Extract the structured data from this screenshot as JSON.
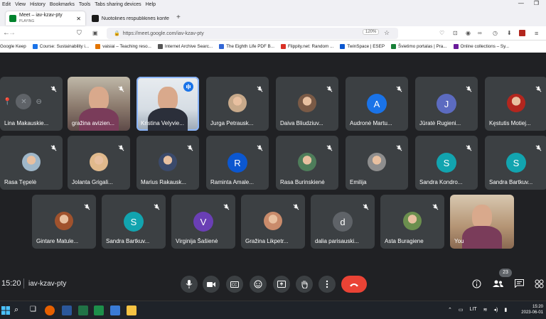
{
  "menubar": {
    "items": [
      "Edit",
      "View",
      "History",
      "Bookmarks",
      "Tools",
      "Tabs sharing devices",
      "Help"
    ]
  },
  "tabs": [
    {
      "title": "Meet – iav-kzav-pty",
      "subtitle": "PLAYING",
      "active": true
    },
    {
      "title": "Nuotolinės respublikinės konfe",
      "active": false
    }
  ],
  "address": {
    "url": "https://meet.google.com/iav-kzav-pty",
    "zoom": "120%"
  },
  "bookmarks": [
    {
      "label": "Google Keep",
      "color": "#fbbc04"
    },
    {
      "label": "Course: Sustainability i...",
      "color": "#1a73e8"
    },
    {
      "label": "vaisiai – Teaching reso...",
      "color": "#e37400"
    },
    {
      "label": "Internet Archive Searc...",
      "color": "#555555"
    },
    {
      "label": "The Eighth Life PDF B...",
      "color": "#3367d6"
    },
    {
      "label": "Flippity.net: Random ...",
      "color": "#d93025"
    },
    {
      "label": "TwinSpace | ESEP",
      "color": "#0b57d0"
    },
    {
      "label": "Švietimo portalas | Pra...",
      "color": "#188038"
    },
    {
      "label": "Online collections – Sy...",
      "color": "#6a1b9a"
    }
  ],
  "participants": [
    {
      "name": "Lina Makauskie...",
      "type": "blank"
    },
    {
      "name": "gražina avizien...",
      "type": "video"
    },
    {
      "name": "Kristina Velyvie...",
      "type": "video-speaking"
    },
    {
      "name": "Jurga Petrausk...",
      "type": "photo",
      "color": "#c7a98a"
    },
    {
      "name": "Daiva Bliudziuv...",
      "type": "photo",
      "color": "#7a5a46"
    },
    {
      "name": "Audronė Martu...",
      "type": "initial",
      "initial": "A",
      "color": "#1a73e8"
    },
    {
      "name": "Jūratė Rugieni...",
      "type": "initial",
      "initial": "J",
      "color": "#5c6bc0"
    },
    {
      "name": "Kęstutis Motiej...",
      "type": "photo",
      "color": "#b3261e"
    },
    {
      "name": "Rasa Tępelė",
      "type": "photo",
      "color": "#9fb7c9"
    },
    {
      "name": "Jolanta Grigali...",
      "type": "photo",
      "color": "#e0b98c"
    },
    {
      "name": "Marius Rakausk...",
      "type": "photo",
      "color": "#3b4a6b"
    },
    {
      "name": "Raminta Amale...",
      "type": "initial",
      "initial": "R",
      "color": "#0b57d0"
    },
    {
      "name": "Rasa Burinskienė",
      "type": "photo",
      "color": "#4e7d5a"
    },
    {
      "name": "Emilija",
      "type": "photo",
      "color": "#8e8e8e"
    },
    {
      "name": "Sandra Kondro...",
      "type": "initial",
      "initial": "S",
      "color": "#12a4af"
    },
    {
      "name": "Sandra Bartkuv...",
      "type": "initial",
      "initial": "S",
      "color": "#12a4af"
    },
    {
      "name": "Gintare Matule...",
      "type": "photo",
      "color": "#a0522d"
    },
    {
      "name": "Sandra Bartkuv...",
      "type": "initial",
      "initial": "S",
      "color": "#12a4af"
    },
    {
      "name": "Virginija Šašienė",
      "type": "initial",
      "initial": "V",
      "color": "#6a3fb5"
    },
    {
      "name": "Gražina Likpetr...",
      "type": "photo",
      "color": "#c98b6b"
    },
    {
      "name": "dalia parisauski...",
      "type": "initial",
      "initial": "d",
      "color": "#5f6368"
    },
    {
      "name": "Asta Buragiene",
      "type": "photo",
      "color": "#6b8f4e"
    },
    {
      "name": "You",
      "type": "self"
    }
  ],
  "controls": {
    "time": "15:20",
    "meeting_code": "iav-kzav-pty",
    "participant_count": "23"
  },
  "taskbar": {
    "time": "15:20",
    "date": "2023-06-01",
    "lang": "LIT"
  },
  "colors": {
    "meet_bg": "#202124",
    "tile_bg": "#3c4043",
    "end_call": "#ea4335",
    "speaking": "#8ab4f8"
  }
}
